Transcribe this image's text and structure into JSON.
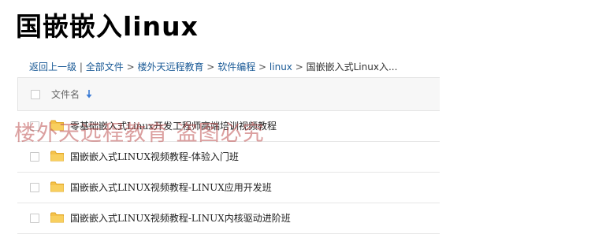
{
  "page": {
    "title": "国嵌嵌入linux"
  },
  "breadcrumb": {
    "items": [
      {
        "label": "返回上一级"
      },
      {
        "label": "全部文件"
      },
      {
        "label": "楼外天远程教育"
      },
      {
        "label": "软件编程"
      },
      {
        "label": "linux"
      }
    ],
    "bar_separator": "|",
    "separator": ">",
    "current": "国嵌嵌入式Linux入..."
  },
  "list": {
    "header": {
      "column_label": "文件名",
      "sort_icon": "sort-down-arrow-icon"
    },
    "rows": [
      {
        "name": "零基础嵌入式Linux开发工程师高端培训视频教程",
        "icon": "folder-icon"
      },
      {
        "name": "国嵌嵌入式LINUX视频教程-体验入门班",
        "icon": "folder-icon"
      },
      {
        "name": "国嵌嵌入式LINUX视频教程-LINUX应用开发班",
        "icon": "folder-icon"
      },
      {
        "name": "国嵌嵌入式LINUX视频教程-LINUX内核驱动进阶班",
        "icon": "folder-icon"
      }
    ]
  },
  "watermark": {
    "text": "楼外天远程教育 盗图必究"
  },
  "colors": {
    "link": "#1a5a96",
    "folder": "#f5c24a",
    "folder_dark": "#e0a82a",
    "sort_arrow": "#3a7bd5",
    "watermark": "#be5050"
  }
}
